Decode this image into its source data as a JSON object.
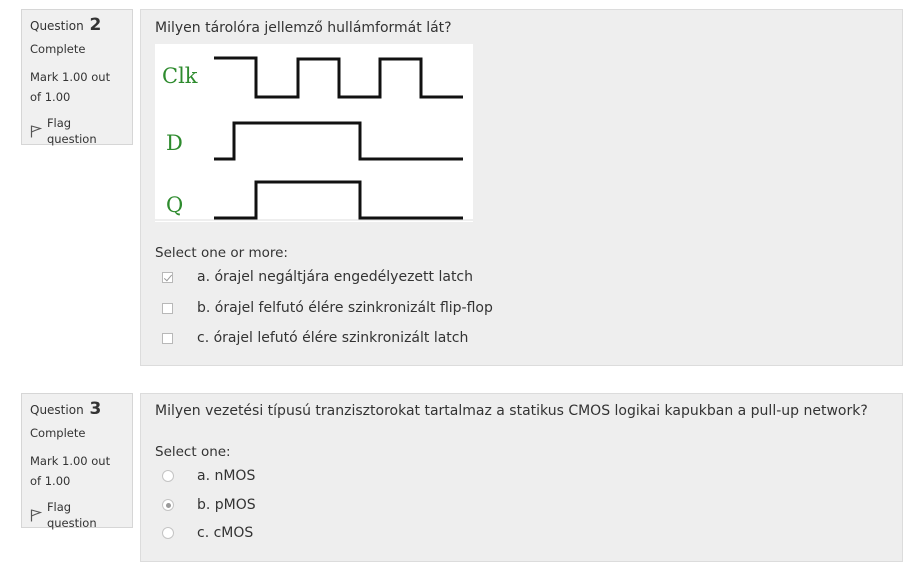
{
  "questions": [
    {
      "info": {
        "label": "Question",
        "number": "2",
        "state": "Complete",
        "mark": "Mark 1.00 out of 1.00",
        "flag_label": "Flag question",
        "flag_icon": "flag-icon"
      },
      "text": "Milyen tárolóra jellemző hullámformát lát?",
      "diagram": {
        "signal_labels": [
          "Clk",
          "D",
          "Q"
        ],
        "label_color": "#2e8b2e"
      },
      "prompt": "Select one or more:",
      "answers": [
        {
          "label": "a. órajel negáltjára engedélyezett latch",
          "checked": true
        },
        {
          "label": "b. órajel felfutó élére szinkronizált flip-flop",
          "checked": false
        },
        {
          "label": "c. órajel lefutó élére szinkronizált latch",
          "checked": false
        }
      ]
    },
    {
      "info": {
        "label": "Question",
        "number": "3",
        "state": "Complete",
        "mark": "Mark 1.00 out of 1.00",
        "flag_label": "Flag question",
        "flag_icon": "flag-icon"
      },
      "text": "Milyen vezetési típusú tranzisztorokat tartalmaz a statikus CMOS logikai kapukban a pull-up network?",
      "prompt": "Select one:",
      "answers": [
        {
          "label": "a. nMOS",
          "checked": false
        },
        {
          "label": "b. pMOS",
          "checked": true
        },
        {
          "label": "c. cMOS",
          "checked": false
        }
      ]
    }
  ],
  "colors": {
    "panel_bg": "#eeeeee",
    "info_bg": "#f0f0f0",
    "text": "#333333"
  }
}
